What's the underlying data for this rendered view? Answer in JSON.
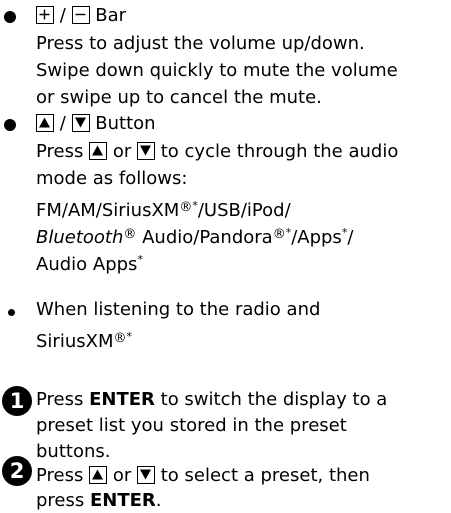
{
  "bar_section": {
    "title": "Bar",
    "separator": "/",
    "lines": [
      "Press to adjust the volume up/down.",
      "Swipe down quickly to mute the volume",
      "or swipe up to cancel the mute."
    ]
  },
  "button_section": {
    "title": "Button",
    "separator": "/",
    "press_word": "Press",
    "or_word": "or",
    "line1_tail": "to cycle through the audio",
    "line2": "mode as follows:",
    "line3": "FM/AM/SiriusXM",
    "line3_tail": "/USB/iPod/",
    "bluetooth_word": "Bluetooth",
    "line4_tail": " Audio/Pandora",
    "line4_end": "/Apps",
    "line4_slash": "/",
    "line5": "Audio Apps",
    "reg_symbol": "®",
    "asterisk": "*"
  },
  "radio_note": {
    "line1": "When listening to the radio and",
    "line2": "SiriusXM"
  },
  "steps": [
    {
      "number": "1",
      "lines": [
        "Press",
        "ENTER",
        "to switch the display to a",
        "preset list you stored in the preset",
        "buttons."
      ]
    },
    {
      "number": "2",
      "press": "Press",
      "or": "or",
      "tail": "to select a preset, then",
      "line2_pre": "press",
      "line2_bold": "ENTER",
      "line2_end": "."
    }
  ]
}
